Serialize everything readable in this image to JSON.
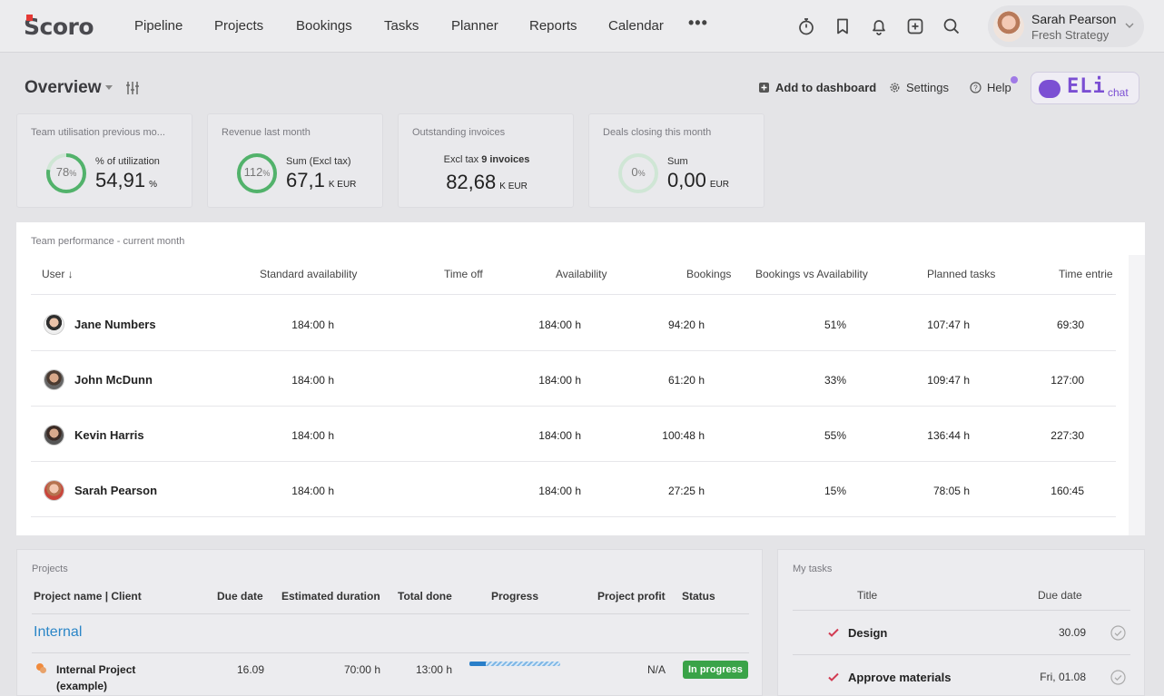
{
  "app": {
    "logo": "Scoro"
  },
  "nav": {
    "items": [
      "Pipeline",
      "Projects",
      "Bookings",
      "Tasks",
      "Planner",
      "Reports",
      "Calendar"
    ],
    "more": "•••"
  },
  "topbar_icons": [
    "stopwatch-icon",
    "bookmark-icon",
    "bell-icon",
    "add-icon",
    "search-icon"
  ],
  "user": {
    "name": "Sarah Pearson",
    "company": "Fresh Strategy"
  },
  "overview": {
    "title": "Overview",
    "add_to_dashboard": "Add to dashboard",
    "settings": "Settings",
    "help": "Help",
    "eli_brand": "ELi",
    "eli_chat": "chat"
  },
  "kpis": {
    "utilisation": {
      "title": "Team utilisation previous mo...",
      "ring_percent": 78,
      "ring_label": "78",
      "ring_unit": "%",
      "caption": "% of utilization",
      "value": "54,91",
      "unit": "%"
    },
    "revenue": {
      "title": "Revenue last month",
      "ring_percent": 100,
      "ring_label": "112",
      "ring_unit": "%",
      "caption": "Sum (Excl tax)",
      "value": "67,1",
      "unit": "K EUR"
    },
    "invoices": {
      "title": "Outstanding invoices",
      "caption_prefix": "Excl tax",
      "caption_count": "9 invoices",
      "value": "82,68",
      "unit": "K EUR"
    },
    "deals": {
      "title": "Deals closing this month",
      "ring_percent": 0,
      "ring_label": "0",
      "ring_unit": "%",
      "caption": "Sum",
      "value": "0,00",
      "unit": "EUR"
    }
  },
  "team_performance": {
    "title": "Team performance - current month",
    "columns": [
      "User ↓",
      "Standard availability",
      "Time off",
      "Availability",
      "Bookings",
      "Bookings vs Availability",
      "Planned tasks",
      "Time entrie"
    ],
    "rows": [
      {
        "user": "Jane Numbers",
        "standard": "184:00 h",
        "time_off": "",
        "availability": "184:00 h",
        "bookings": "94:20 h",
        "bva": "51%",
        "planned": "107:47 h",
        "time_entries": "69:30"
      },
      {
        "user": "John McDunn",
        "standard": "184:00 h",
        "time_off": "",
        "availability": "184:00 h",
        "bookings": "61:20 h",
        "bva": "33%",
        "planned": "109:47 h",
        "time_entries": "127:00"
      },
      {
        "user": "Kevin Harris",
        "standard": "184:00 h",
        "time_off": "",
        "availability": "184:00 h",
        "bookings": "100:48 h",
        "bva": "55%",
        "planned": "136:44 h",
        "time_entries": "227:30"
      },
      {
        "user": "Sarah Pearson",
        "standard": "184:00 h",
        "time_off": "",
        "availability": "184:00 h",
        "bookings": "27:25 h",
        "bva": "15%",
        "planned": "78:05 h",
        "time_entries": "160:45"
      }
    ]
  },
  "projects": {
    "title": "Projects",
    "columns": [
      "Project name | Client",
      "Due date",
      "Estimated duration",
      "Total done",
      "Progress",
      "Project profit",
      "Status"
    ],
    "group": "Internal",
    "rows": [
      {
        "name": "Internal Project (example)",
        "due": "16.09",
        "estimated": "70:00 h",
        "done": "13:00 h",
        "progress_percent": 18,
        "profit": "N/A",
        "status": "In progress"
      }
    ]
  },
  "my_tasks": {
    "title": "My tasks",
    "columns": [
      "Title",
      "Due date"
    ],
    "rows": [
      {
        "title": "Design",
        "due": "30.09"
      },
      {
        "title": "Approve materials",
        "due": "Fri, 01.08"
      }
    ]
  },
  "colors": {
    "accent_blue": "#2b86c7",
    "ring_green": "#52b26b",
    "status_green": "#3aa348",
    "eli_purple": "#7b4fd3",
    "task_check_red": "#d23b52"
  }
}
